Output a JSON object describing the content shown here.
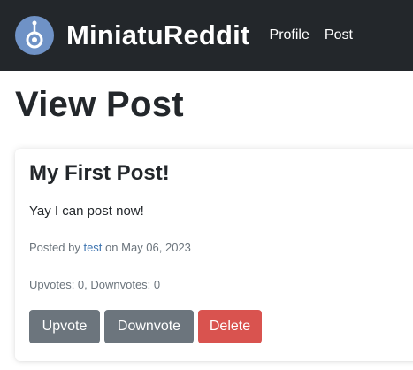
{
  "navbar": {
    "brand": "MiniatuReddit",
    "links": [
      "Profile",
      "Post"
    ]
  },
  "page": {
    "title": "View Post"
  },
  "post": {
    "title": "My First Post!",
    "body": "Yay I can post now!",
    "posted_by_prefix": "Posted by",
    "author": "test",
    "date_prefix": "on",
    "date": "May 06, 2023",
    "votes_text": "Upvotes: 0, Downvotes: 0"
  },
  "actions": {
    "upvote": "Upvote",
    "downvote": "Downvote",
    "delete": "Delete"
  },
  "colors": {
    "navbar_bg": "#23272b",
    "logo_bg": "#6f92c6",
    "secondary_btn": "#6c757d",
    "danger_btn": "#d9534f",
    "link": "#3d74b0"
  },
  "icons": {
    "logo": "reddit-like-logo-icon"
  }
}
